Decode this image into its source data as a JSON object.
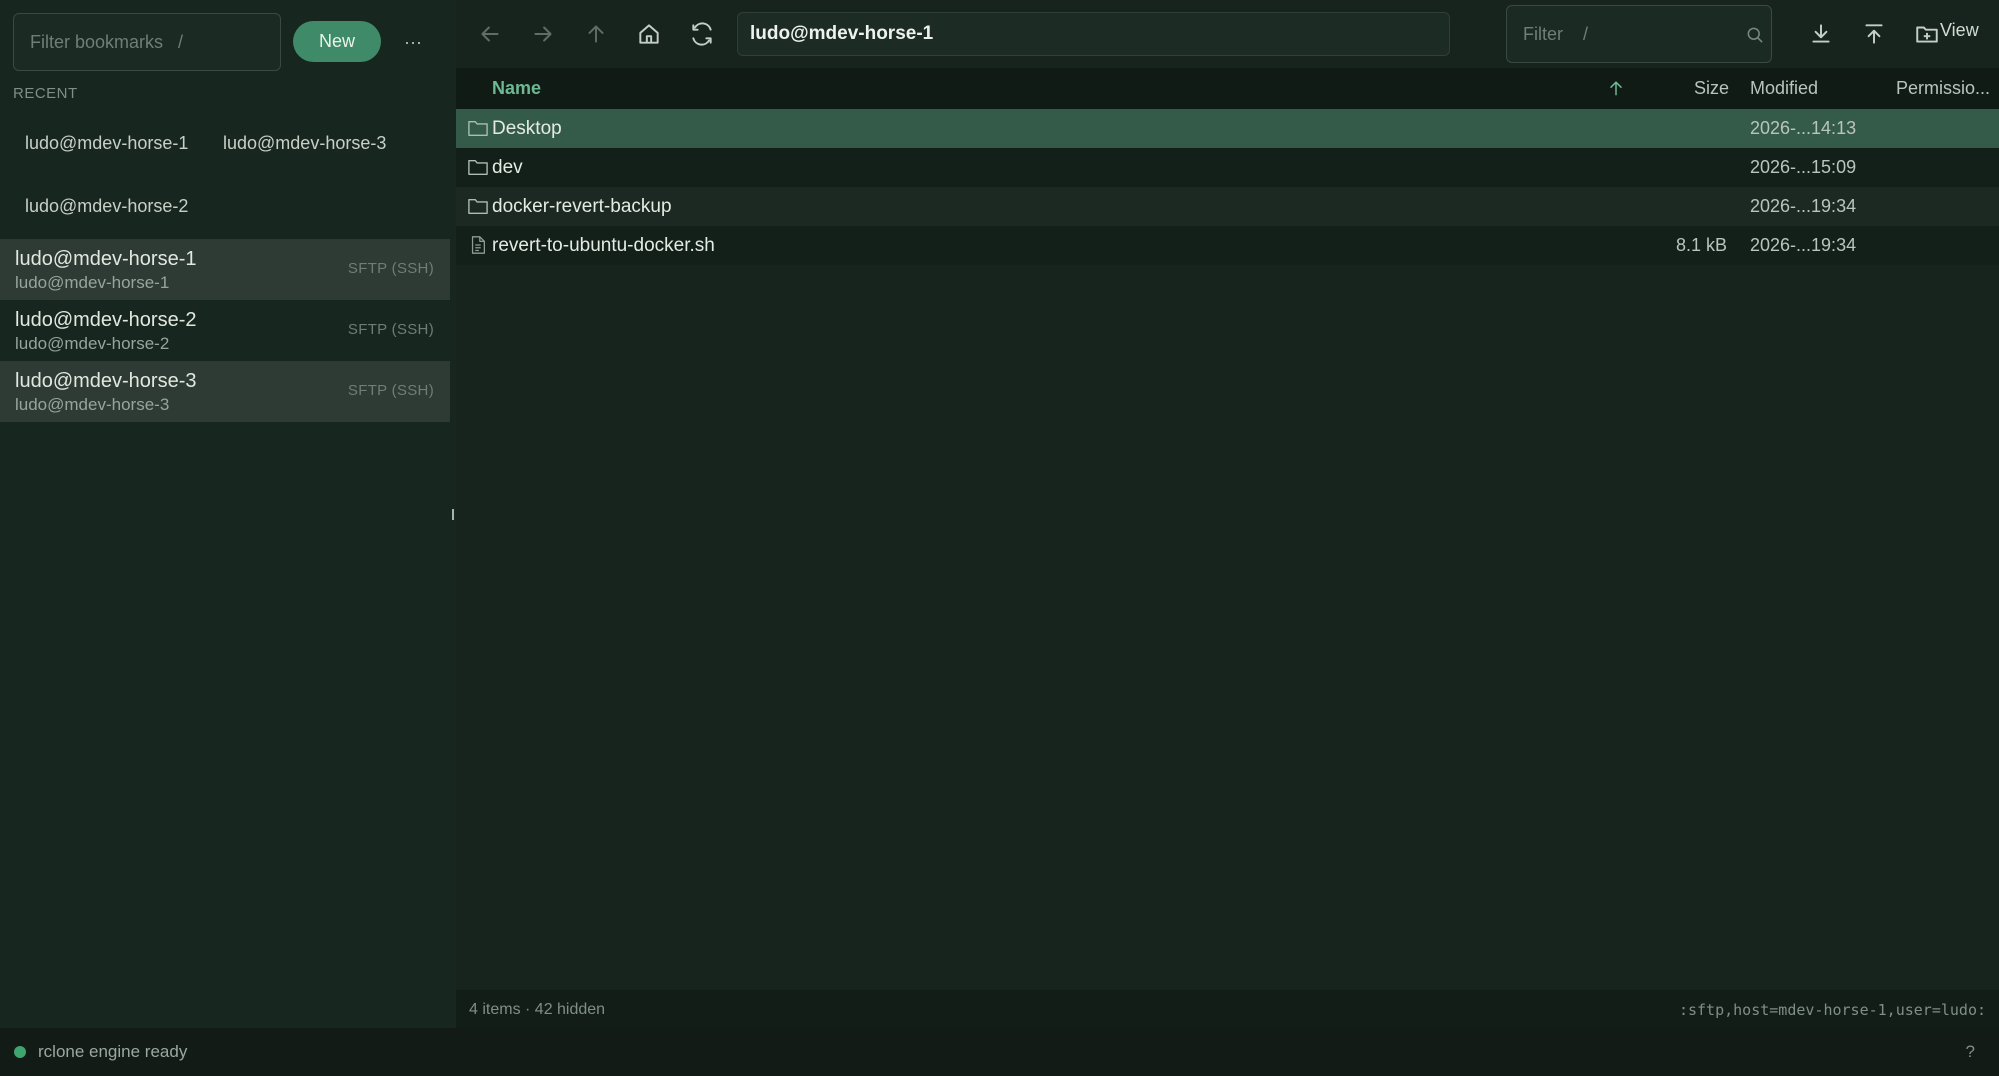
{
  "sidebar": {
    "filter_placeholder": "Filter bookmarks   /",
    "new_label": "New",
    "more_label": "···",
    "recent_label": "RECENT",
    "recent": [
      "ludo@mdev-horse-1",
      "ludo@mdev-horse-3",
      "ludo@mdev-horse-2"
    ],
    "connections": [
      {
        "title": "ludo@mdev-horse-1",
        "subtitle": "ludo@mdev-horse-1",
        "protocol": "SFTP (SSH)",
        "highlighted": true
      },
      {
        "title": "ludo@mdev-horse-2",
        "subtitle": "ludo@mdev-horse-2",
        "protocol": "SFTP (SSH)",
        "highlighted": false
      },
      {
        "title": "ludo@mdev-horse-3",
        "subtitle": "ludo@mdev-horse-3",
        "protocol": "SFTP (SSH)",
        "highlighted": true
      }
    ]
  },
  "toolbar": {
    "path": "ludo@mdev-horse-1",
    "filter_placeholder": "Filter    /",
    "view_label": "View",
    "icons": [
      "back-arrow-icon",
      "forward-arrow-icon",
      "up-arrow-icon",
      "home-icon",
      "refresh-icon",
      "download-icon",
      "upload-icon",
      "new-folder-icon"
    ]
  },
  "file_list": {
    "columns": {
      "name": "Name",
      "size": "Size",
      "modified": "Modified",
      "permissions": "Permissio..."
    },
    "sort": {
      "column": "name",
      "direction": "ascending"
    },
    "rows": [
      {
        "type": "folder",
        "name": "Desktop",
        "size": "",
        "modified": "2026-...14:13",
        "selected": true
      },
      {
        "type": "folder",
        "name": "dev",
        "size": "",
        "modified": "2026-...15:09",
        "selected": false
      },
      {
        "type": "folder",
        "name": "docker-revert-backup",
        "size": "",
        "modified": "2026-...19:34",
        "selected": false
      },
      {
        "type": "file",
        "name": "revert-to-ubuntu-docker.sh",
        "size": "8.1 kB",
        "modified": "2026-...19:34",
        "selected": false
      }
    ]
  },
  "footer": {
    "count": "4 items · 42 hidden",
    "remote": ":sftp,host=mdev-horse-1,user=ludo:"
  },
  "statusbar": {
    "text": "rclone engine ready",
    "help": "?"
  },
  "colors": {
    "accent": "#3f8a68",
    "selected_row": "#345b49",
    "status_dot": "#3ea56f"
  }
}
